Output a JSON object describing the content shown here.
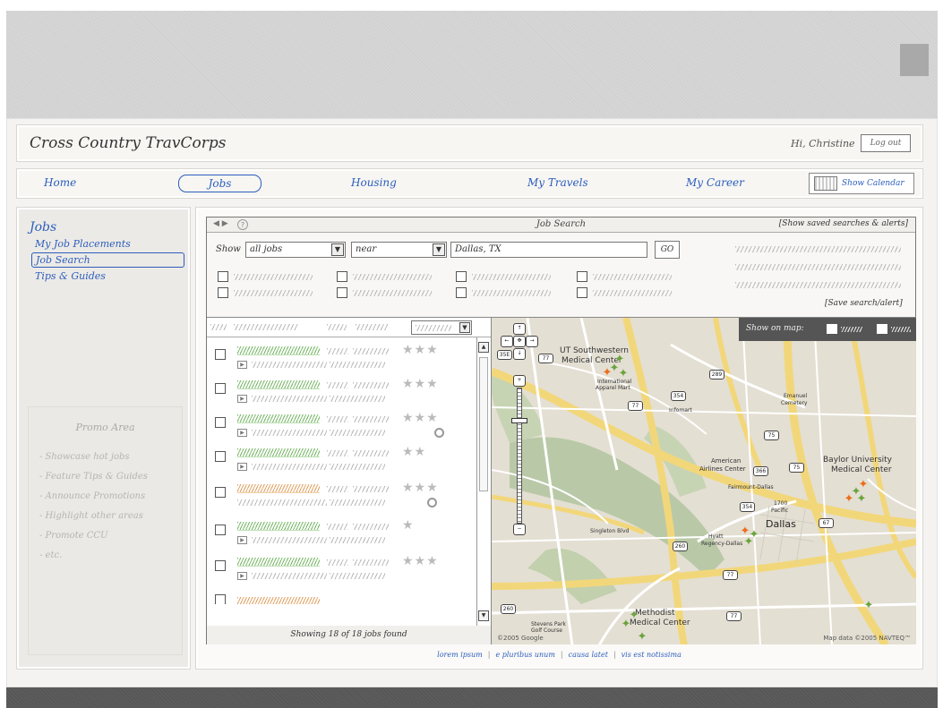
{
  "header": {
    "site_title": "Cross Country TravCorps",
    "greeting": "Hi, Christine",
    "logout_label": "Log out"
  },
  "nav": {
    "home": "Home",
    "jobs": "Jobs",
    "housing": "Housing",
    "my_travels": "My Travels",
    "my_career": "My Career",
    "show_calendar": "Show Calendar",
    "active_tab": "Jobs"
  },
  "sidebar": {
    "heading": "Jobs",
    "items": [
      {
        "label": "My Job Placements",
        "selected": false
      },
      {
        "label": "Job Search",
        "selected": true
      },
      {
        "label": "Tips & Guides",
        "selected": false
      }
    ],
    "promo": {
      "title": "Promo Area",
      "items": [
        "- Showcase hot jobs",
        "- Feature Tips & Guides",
        "- Announce Promotions",
        "- Highlight other areas",
        "- Promote CCU",
        "- etc."
      ]
    }
  },
  "window": {
    "title": "Job Search",
    "nav_arrows": "◀ ▶",
    "help": "?",
    "saved_searches_link": "[Show saved searches & alerts]"
  },
  "search": {
    "show_label": "Show",
    "show_value": "all jobs",
    "near_value": "near",
    "location_value": "Dallas, TX",
    "go_label": "GO",
    "save_link": "[Save search/alert]"
  },
  "job_list": {
    "footer": "Showing 18 of 18 jobs found",
    "jobs": [
      {
        "stars": "★★★",
        "highlight": "green",
        "saved": false
      },
      {
        "stars": "★★★",
        "highlight": "green",
        "saved": false
      },
      {
        "stars": "★★★",
        "highlight": "green",
        "saved": true
      },
      {
        "stars": "★★",
        "highlight": "green",
        "saved": false
      },
      {
        "stars": "★★★",
        "highlight": "orange",
        "saved": true
      },
      {
        "stars": "★",
        "highlight": "green",
        "saved": false
      },
      {
        "stars": "★★★",
        "highlight": "green",
        "saved": false
      }
    ]
  },
  "map": {
    "toolbar_label": "Show on map:",
    "labels": {
      "ut": "UT Southwestern",
      "ut2": "Medical Center",
      "intl": "International",
      "intl2": "Apparel Mart",
      "infomart": "Infomart",
      "emanuel": "Emanuel",
      "emanuel2": "Cemetery",
      "baylor": "Baylor University",
      "baylor2": "Medical Center",
      "american": "American",
      "american2": "Airlines Center",
      "fairmount": "Fairmount-Dallas",
      "fifteen": "1700",
      "pacific": "Pacific",
      "dallas": "Dallas",
      "hyatt": "Hyatt",
      "hyatt2": "Regency-Dallas",
      "singleton": "Singleton Blvd",
      "methodist": "Methodist",
      "methodist2": "Medical Center",
      "stevens": "Stevens Park",
      "golf": "Golf Course"
    },
    "highways": [
      "35E",
      "77",
      "289",
      "354",
      "77",
      "75",
      "366",
      "75",
      "354",
      "67",
      "260",
      "77",
      "260",
      "77"
    ],
    "copyright_left": "©2005 Google",
    "copyright_right": "Map data ©2005 NAVTEQ™"
  },
  "footer_links": [
    "lorem ipsum",
    "e pluribus unum",
    "causa latet",
    "vis est notissima"
  ]
}
